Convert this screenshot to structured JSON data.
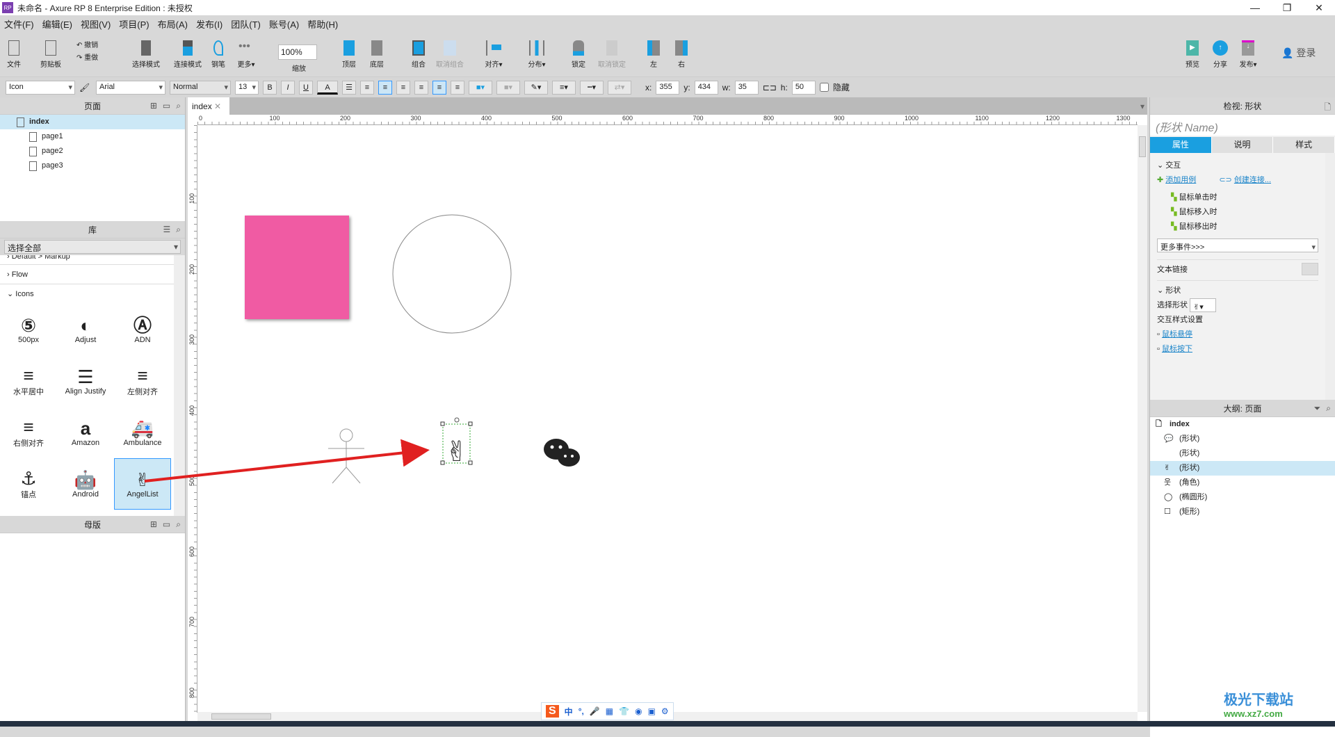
{
  "window": {
    "title": "未命名 - Axure RP 8 Enterprise Edition : 未授权",
    "logo": "RP",
    "controls": [
      "—",
      "❐",
      "✕"
    ]
  },
  "menu": [
    "文件(F)",
    "编辑(E)",
    "视图(V)",
    "项目(P)",
    "布局(A)",
    "发布(I)",
    "团队(T)",
    "账号(A)",
    "帮助(H)"
  ],
  "toolbar": {
    "file": "文件",
    "clipboard": "剪贴板",
    "undo": "撤销",
    "redo": "重做",
    "select_mode": "选择模式",
    "connect_mode": "连接模式",
    "pen": "钢笔",
    "more": "更多▾",
    "zoom_value": "100%",
    "zoom_label": "缩放",
    "front": "顶层",
    "back": "底层",
    "group": "组合",
    "ungroup": "取消组合",
    "align": "对齐▾",
    "distribute": "分布▾",
    "lock": "锁定",
    "unlock": "取消锁定",
    "left": "左",
    "right": "右",
    "preview": "预览",
    "share": "分享",
    "publish": "发布▾",
    "login": "登录"
  },
  "format": {
    "style": "Icon",
    "font": "Arial",
    "weight": "Normal",
    "size": "13",
    "bold": "B",
    "italic": "I",
    "underline": "U",
    "font_color": "A",
    "x_label": "x:",
    "x": "355",
    "y_label": "y:",
    "y": "434",
    "w_label": "w:",
    "w": "35",
    "h_label": "h:",
    "h": "50",
    "hidden": "隐藏",
    "hidden_checked": false
  },
  "pages": {
    "title": "页面",
    "items": [
      "index",
      "page1",
      "page2",
      "page3"
    ],
    "selected": "index"
  },
  "library": {
    "title": "库",
    "filter": "选择全部",
    "groups": [
      "Default > Markup",
      "Flow",
      "Icons"
    ],
    "icons": [
      {
        "label": "500px",
        "glyph": "⑤"
      },
      {
        "label": "Adjust",
        "glyph": "◐"
      },
      {
        "label": "ADN",
        "glyph": "Ⓐ"
      },
      {
        "label": "水平居中",
        "glyph": "≡"
      },
      {
        "label": "Align Justify",
        "glyph": "☰"
      },
      {
        "label": "左侧对齐",
        "glyph": "≡"
      },
      {
        "label": "右侧对齐",
        "glyph": "≡"
      },
      {
        "label": "Amazon",
        "glyph": "a"
      },
      {
        "label": "Ambulance",
        "glyph": "🚑"
      },
      {
        "label": "锚点",
        "glyph": "⚓"
      },
      {
        "label": "Android",
        "glyph": "🤖"
      },
      {
        "label": "AngelList",
        "glyph": "✌"
      }
    ],
    "selected": "AngelList"
  },
  "masters": {
    "title": "母版"
  },
  "canvas": {
    "tab": "index",
    "ruler_h": [
      "0",
      "100",
      "200",
      "300",
      "400",
      "500",
      "600",
      "700",
      "800",
      "900",
      "1000",
      "1100",
      "1200",
      "1300"
    ],
    "ruler_v": [
      "100",
      "200",
      "300",
      "400",
      "500",
      "600",
      "700",
      "800"
    ],
    "rect_color": "#f05ba3",
    "arrow_color": "#e02020"
  },
  "inspector": {
    "title": "检视: 形状",
    "name_placeholder": "(形状 Name)",
    "tabs": [
      "属性",
      "说明",
      "样式"
    ],
    "active_tab": "属性",
    "interaction": "交互",
    "add_case": "添加用例",
    "create_link": "创建连接...",
    "events": [
      "鼠标单击时",
      "鼠标移入时",
      "鼠标移出时"
    ],
    "more_events": "更多事件>>>",
    "text_link": "文本链接",
    "shape_section": "形状",
    "select_shape": "选择形状",
    "interaction_styles": "交互样式设置",
    "hover": "鼠标悬停",
    "mousedown": "鼠标按下",
    "accent": "#1a9fe0"
  },
  "outline": {
    "title": "大纲: 页面",
    "root": "index",
    "items": [
      {
        "label": "(形状)",
        "icon": "wechat-icon"
      },
      {
        "label": "(形状)",
        "icon": "apple-icon"
      },
      {
        "label": "(形状)",
        "icon": "angellist-icon",
        "selected": true
      },
      {
        "label": "(角色)",
        "icon": "actor-icon"
      },
      {
        "label": "(椭圆形)",
        "icon": "ellipse-icon"
      },
      {
        "label": "(矩形)",
        "icon": "rect-icon"
      }
    ]
  },
  "watermark": {
    "name": "极光下载站",
    "url": "www.xz7.com"
  },
  "ime": [
    "中",
    "°,",
    "🎤",
    "▦",
    "👕",
    "◉",
    "▣",
    "⚙"
  ]
}
